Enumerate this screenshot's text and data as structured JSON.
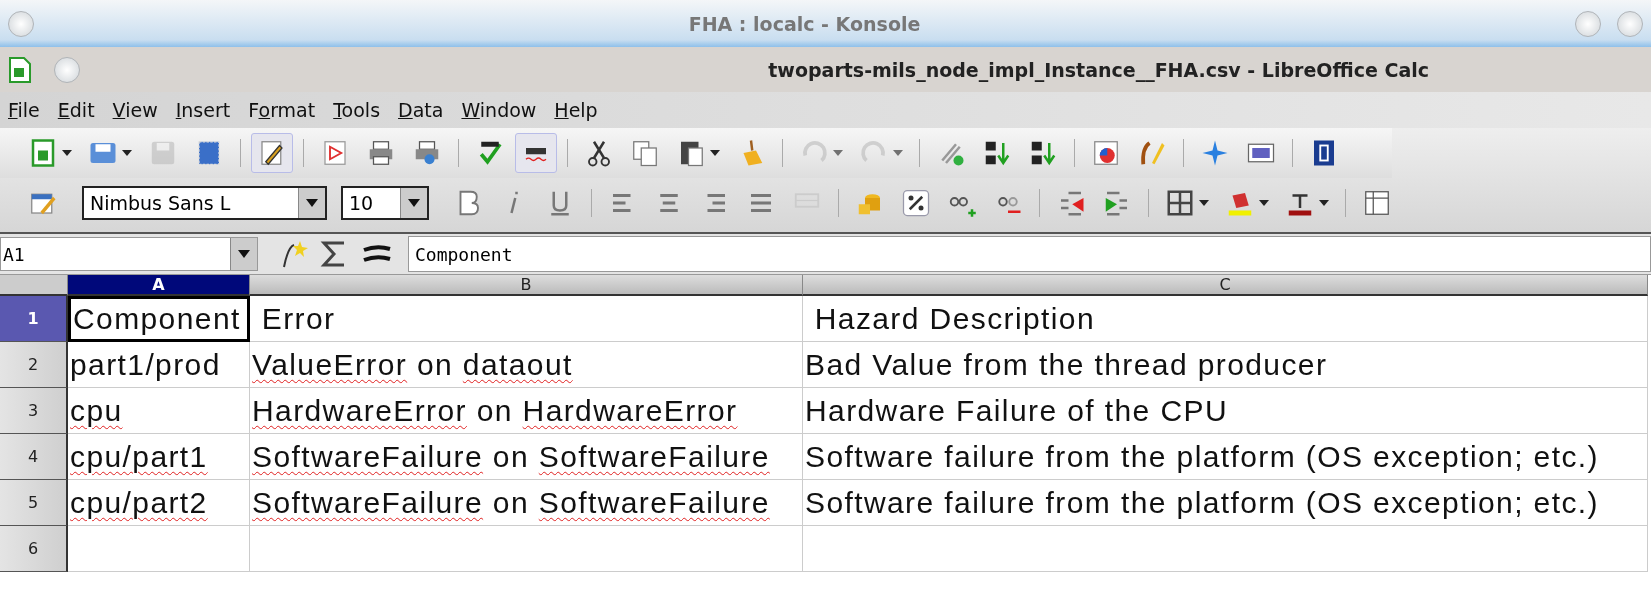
{
  "outer_window": {
    "title": "FHA : localc - Konsole"
  },
  "window": {
    "title": "twoparts-mils_node_impl_Instance__FHA.csv - LibreOffice Calc"
  },
  "menu": [
    {
      "mnemonic": "F",
      "rest": "ile"
    },
    {
      "mnemonic": "E",
      "rest": "dit"
    },
    {
      "mnemonic": "V",
      "rest": "iew"
    },
    {
      "mnemonic": "I",
      "rest": "nsert"
    },
    {
      "prefix": "F",
      "mnemonic": "o",
      "rest": "rmat"
    },
    {
      "mnemonic": "T",
      "rest": "ools"
    },
    {
      "mnemonic": "D",
      "rest": "ata"
    },
    {
      "mnemonic": "W",
      "rest": "indow"
    },
    {
      "mnemonic": "H",
      "rest": "elp"
    }
  ],
  "toolbar": {
    "edit_mode_on": true,
    "auto_spellcheck_on": true,
    "save_disabled": true,
    "undo_disabled": true,
    "redo_disabled": true
  },
  "format_bar": {
    "font_name": "Nimbus Sans L",
    "font_size": "10"
  },
  "formula_bar": {
    "cell_reference": "A1",
    "content": "Component"
  },
  "sheet": {
    "columns": [
      {
        "label": "A",
        "selected": true
      },
      {
        "label": "B",
        "selected": false
      },
      {
        "label": "C",
        "selected": false
      }
    ],
    "rows": [
      {
        "number": "1",
        "selected": true,
        "cells": [
          {
            "segments": [
              {
                "text": "Component",
                "flagged": false
              }
            ],
            "selected": true
          },
          {
            "segments": [
              {
                "text": " Error",
                "flagged": false
              }
            ],
            "selected": false
          },
          {
            "segments": [
              {
                "text": " Hazard Description",
                "flagged": false
              }
            ],
            "selected": false
          }
        ]
      },
      {
        "number": "2",
        "selected": false,
        "cells": [
          {
            "segments": [
              {
                "text": "part1/prod",
                "flagged": false
              }
            ],
            "selected": false
          },
          {
            "segments": [
              {
                "text": "ValueError",
                "flagged": true
              },
              {
                "text": " on ",
                "flagged": false
              },
              {
                "text": "dataout",
                "flagged": true
              }
            ],
            "selected": false
          },
          {
            "segments": [
              {
                "text": "Bad Value from the thread producer",
                "flagged": false
              }
            ],
            "selected": false
          }
        ]
      },
      {
        "number": "3",
        "selected": false,
        "cells": [
          {
            "segments": [
              {
                "text": "cpu",
                "flagged": true
              }
            ],
            "selected": false
          },
          {
            "segments": [
              {
                "text": "HardwareError",
                "flagged": true
              },
              {
                "text": " on ",
                "flagged": false
              },
              {
                "text": "HardwareError",
                "flagged": true
              }
            ],
            "selected": false
          },
          {
            "segments": [
              {
                "text": "Hardware Failure of the CPU",
                "flagged": false
              }
            ],
            "selected": false
          }
        ]
      },
      {
        "number": "4",
        "selected": false,
        "cells": [
          {
            "segments": [
              {
                "text": "cpu/part1",
                "flagged": true
              }
            ],
            "selected": false
          },
          {
            "segments": [
              {
                "text": "SoftwareFailure",
                "flagged": true
              },
              {
                "text": " on ",
                "flagged": false
              },
              {
                "text": "SoftwareFailure",
                "flagged": true
              }
            ],
            "selected": false
          },
          {
            "segments": [
              {
                "text": "Software failure from the platform (OS exception; etc.)",
                "flagged": false
              }
            ],
            "selected": false
          }
        ]
      },
      {
        "number": "5",
        "selected": false,
        "cells": [
          {
            "segments": [
              {
                "text": "cpu/part2",
                "flagged": true
              }
            ],
            "selected": false
          },
          {
            "segments": [
              {
                "text": "SoftwareFailure",
                "flagged": true
              },
              {
                "text": " on ",
                "flagged": false
              },
              {
                "text": "SoftwareFailure",
                "flagged": true
              }
            ],
            "selected": false
          },
          {
            "segments": [
              {
                "text": "Software failure from the platform (OS exception; etc.)",
                "flagged": false
              }
            ],
            "selected": false
          }
        ]
      },
      {
        "number": "6",
        "selected": false,
        "cells": [
          {
            "selected": false
          },
          {
            "selected": false
          },
          {
            "selected": false
          }
        ]
      }
    ]
  }
}
